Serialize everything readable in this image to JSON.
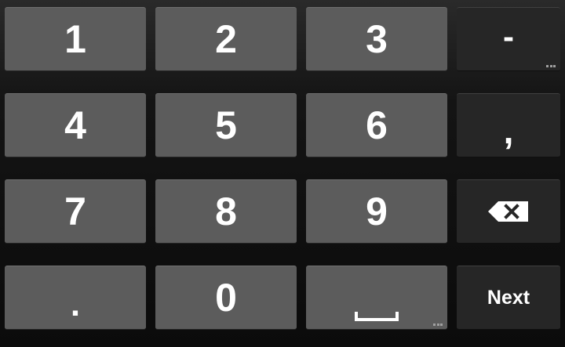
{
  "keyboard": {
    "rows": [
      [
        "1",
        "2",
        "3",
        "-"
      ],
      [
        "4",
        "5",
        "6",
        ","
      ],
      [
        "7",
        "8",
        "9",
        "backspace"
      ],
      [
        ".",
        "0",
        "space",
        "Next"
      ]
    ],
    "keys": {
      "one": "1",
      "two": "2",
      "three": "3",
      "four": "4",
      "five": "5",
      "six": "6",
      "seven": "7",
      "eight": "8",
      "nine": "9",
      "zero": "0",
      "minus": "-",
      "comma": ",",
      "period": ".",
      "next": "Next"
    },
    "icons": {
      "backspace": "backspace-icon",
      "space": "space-bar-icon",
      "more_keys_hint": "more-keys-hint-icon"
    },
    "colors": {
      "number_key": "#5c5c5c",
      "function_key": "#262626",
      "text": "#ffffff"
    }
  }
}
